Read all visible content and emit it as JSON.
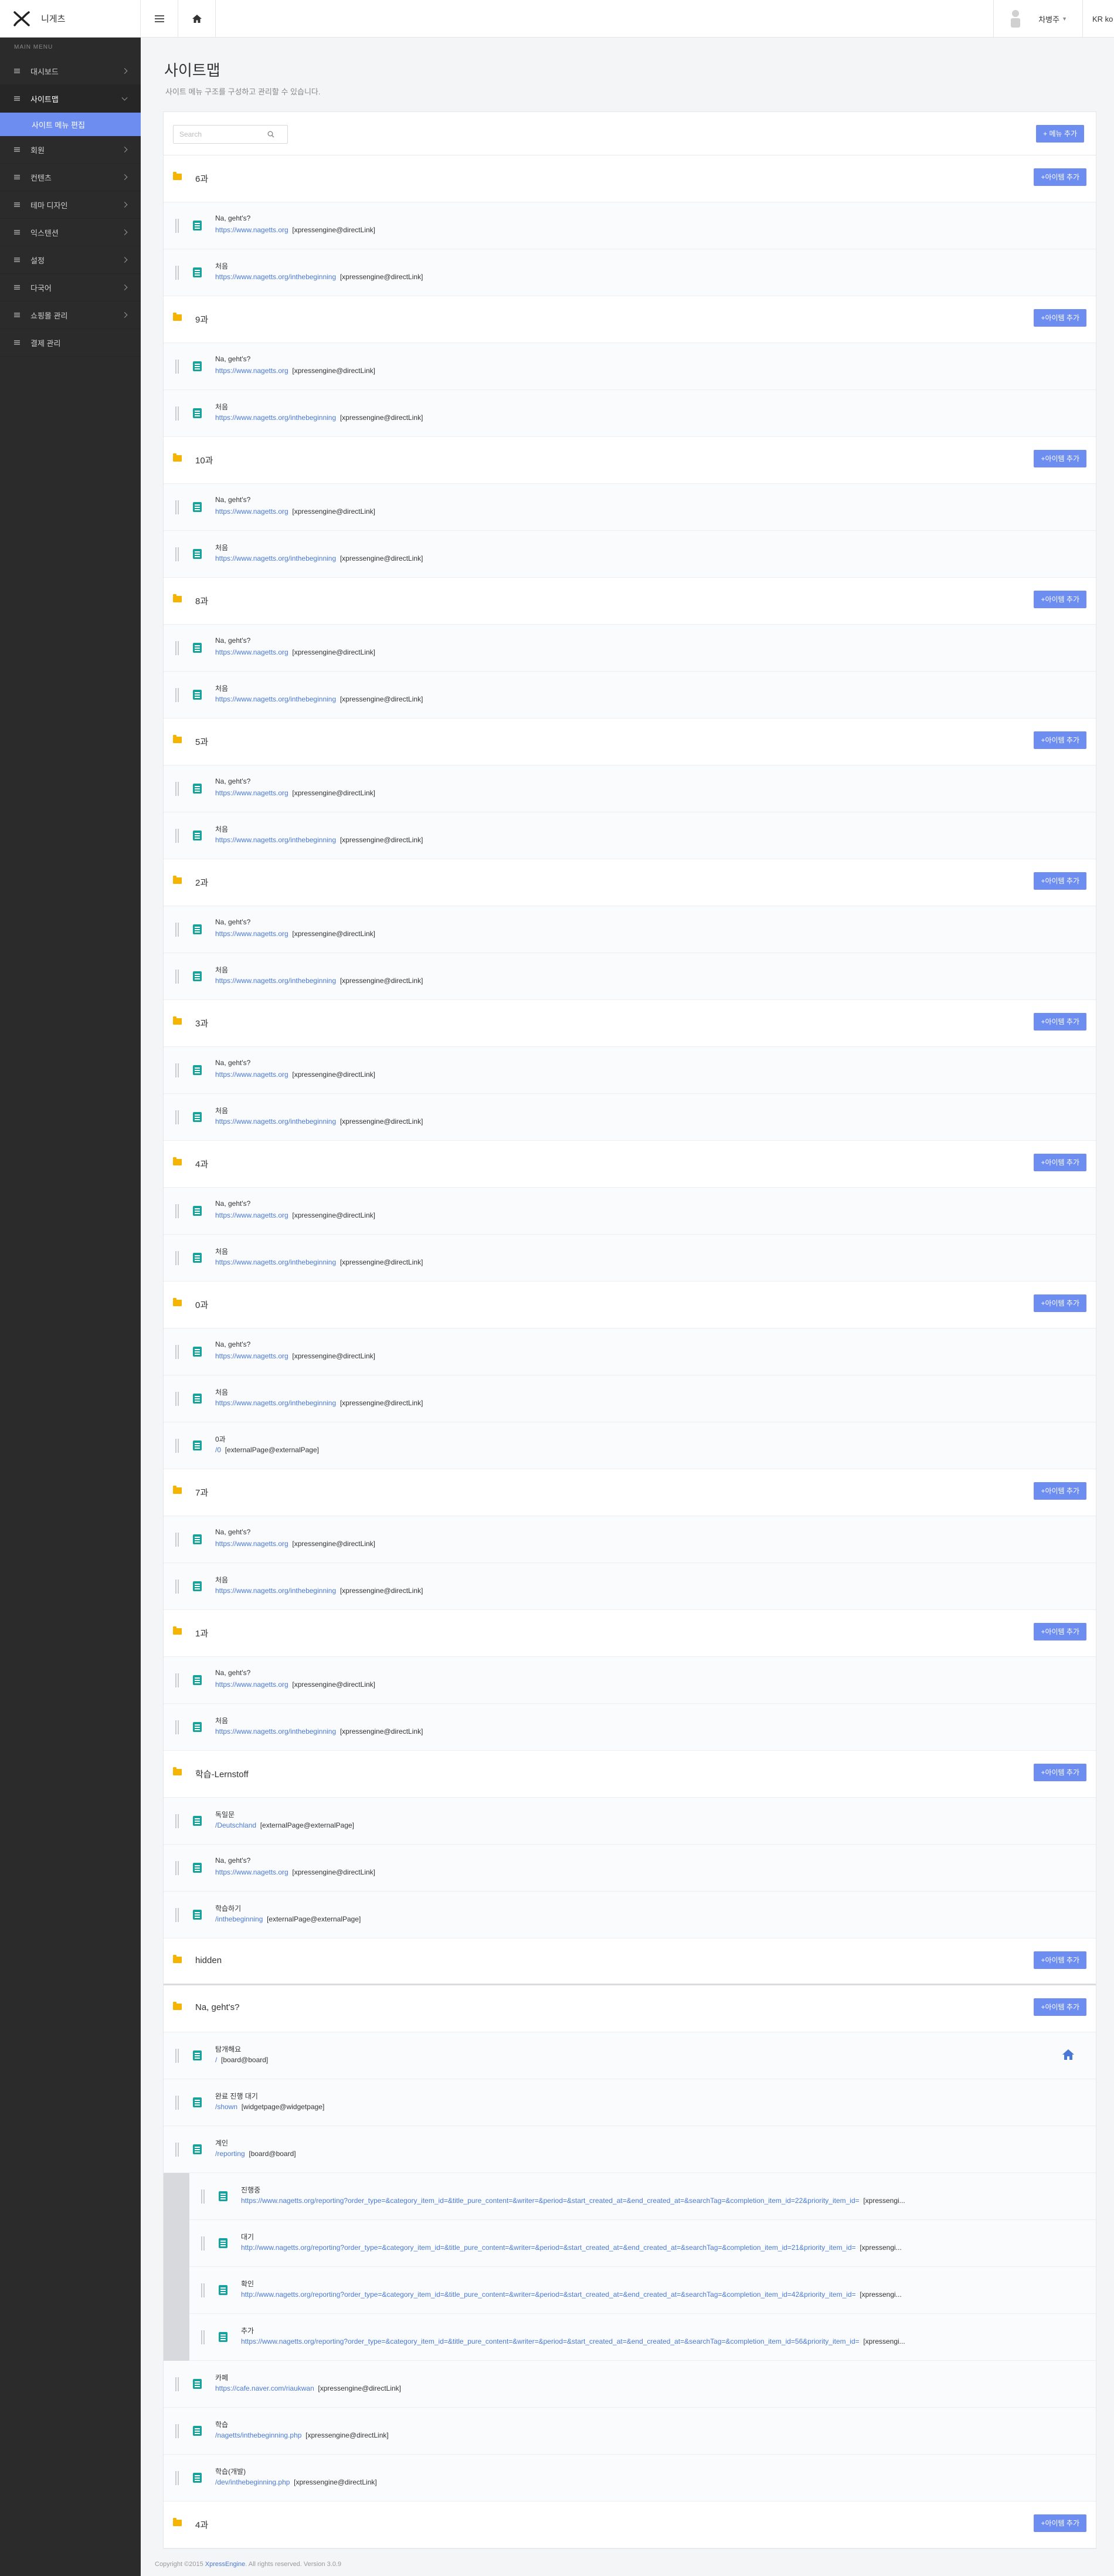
{
  "header": {
    "site_name": "니게츠",
    "user_name": "차병주",
    "lang": "KR ko"
  },
  "sidebar": {
    "heading": "MAIN MENU",
    "items": [
      {
        "label": "대시보드"
      },
      {
        "label": "사이트맵"
      },
      {
        "label": "회원"
      },
      {
        "label": "컨텐츠"
      },
      {
        "label": "테마 디자인"
      },
      {
        "label": "익스텐션"
      },
      {
        "label": "설정"
      },
      {
        "label": "다국어"
      },
      {
        "label": "쇼핑몰 관리"
      },
      {
        "label": "결제 관리"
      }
    ],
    "active_sub": "사이트 메뉴 편집"
  },
  "page": {
    "title": "사이트맵",
    "description": "사이트 메뉴 구조를 구성하고 관리할 수 있습니다.",
    "search_placeholder": "Search",
    "add_menu_label": "+ 메뉴 추가",
    "add_item_label": "+아이템 추가"
  },
  "menus": [
    {
      "title": "6과",
      "items": [
        {
          "title": "Na, geht's?",
          "url": "https://www.nagetts.org",
          "type": "[xpressengine@directLink]"
        },
        {
          "title": "처음",
          "url": "https://www.nagetts.org/inthebeginning",
          "type": "[xpressengine@directLink]"
        }
      ]
    },
    {
      "title": "9과",
      "items": [
        {
          "title": "Na, geht's?",
          "url": "https://www.nagetts.org",
          "type": "[xpressengine@directLink]"
        },
        {
          "title": "처음",
          "url": "https://www.nagetts.org/inthebeginning",
          "type": "[xpressengine@directLink]"
        }
      ]
    },
    {
      "title": "10과",
      "items": [
        {
          "title": "Na, geht's?",
          "url": "https://www.nagetts.org",
          "type": "[xpressengine@directLink]"
        },
        {
          "title": "처음",
          "url": "https://www.nagetts.org/inthebeginning",
          "type": "[xpressengine@directLink]"
        }
      ]
    },
    {
      "title": "8과",
      "items": [
        {
          "title": "Na, geht's?",
          "url": "https://www.nagetts.org",
          "type": "[xpressengine@directLink]"
        },
        {
          "title": "처음",
          "url": "https://www.nagetts.org/inthebeginning",
          "type": "[xpressengine@directLink]"
        }
      ]
    },
    {
      "title": "5과",
      "items": [
        {
          "title": "Na, geht's?",
          "url": "https://www.nagetts.org",
          "type": "[xpressengine@directLink]"
        },
        {
          "title": "처음",
          "url": "https://www.nagetts.org/inthebeginning",
          "type": "[xpressengine@directLink]"
        }
      ]
    },
    {
      "title": "2과",
      "items": [
        {
          "title": "Na, geht's?",
          "url": "https://www.nagetts.org",
          "type": "[xpressengine@directLink]"
        },
        {
          "title": "처음",
          "url": "https://www.nagetts.org/inthebeginning",
          "type": "[xpressengine@directLink]"
        }
      ]
    },
    {
      "title": "3과",
      "items": [
        {
          "title": "Na, geht's?",
          "url": "https://www.nagetts.org",
          "type": "[xpressengine@directLink]"
        },
        {
          "title": "처음",
          "url": "https://www.nagetts.org/inthebeginning",
          "type": "[xpressengine@directLink]"
        }
      ]
    },
    {
      "title": "4과",
      "items": [
        {
          "title": "Na, geht's?",
          "url": "https://www.nagetts.org",
          "type": "[xpressengine@directLink]"
        },
        {
          "title": "처음",
          "url": "https://www.nagetts.org/inthebeginning",
          "type": "[xpressengine@directLink]"
        }
      ]
    },
    {
      "title": "0과",
      "items": [
        {
          "title": "Na, geht's?",
          "url": "https://www.nagetts.org",
          "type": "[xpressengine@directLink]"
        },
        {
          "title": "처음",
          "url": "https://www.nagetts.org/inthebeginning",
          "type": "[xpressengine@directLink]"
        },
        {
          "title": "0과",
          "url": "/0",
          "type": "[externalPage@externalPage]"
        }
      ]
    },
    {
      "title": "7과",
      "items": [
        {
          "title": "Na, geht's?",
          "url": "https://www.nagetts.org",
          "type": "[xpressengine@directLink]"
        },
        {
          "title": "처음",
          "url": "https://www.nagetts.org/inthebeginning",
          "type": "[xpressengine@directLink]"
        }
      ]
    },
    {
      "title": "1과",
      "items": [
        {
          "title": "Na, geht's?",
          "url": "https://www.nagetts.org",
          "type": "[xpressengine@directLink]"
        },
        {
          "title": "처음",
          "url": "https://www.nagetts.org/inthebeginning",
          "type": "[xpressengine@directLink]"
        }
      ]
    },
    {
      "title": "학습-Lernstoff",
      "items": [
        {
          "title": "독일문",
          "url": "/Deutschland",
          "type": "[externalPage@externalPage]"
        },
        {
          "title": "Na, geht's?",
          "url": "https://www.nagetts.org",
          "type": "[xpressengine@directLink]"
        },
        {
          "title": "학습하기",
          "url": "/inthebeginning",
          "type": "[externalPage@externalPage]"
        }
      ]
    },
    {
      "title": "hidden",
      "items": []
    },
    {
      "title": "Na, geht's?",
      "items": [
        {
          "title": "탐개해요",
          "url": "/",
          "type": "[board@board]",
          "home": true
        },
        {
          "title": "완료 진행 대기",
          "url": "/shown",
          "type": "[widgetpage@widgetpage]"
        },
        {
          "title": "계인",
          "url": "/reporting",
          "type": "[board@board]"
        },
        {
          "title": "진행중",
          "url": "https://www.nagetts.org/reporting?order_type=&category_item_id=&title_pure_content=&writer=&period=&start_created_at=&end_created_at=&searchTag=&completion_item_id=22&priority_item_id=",
          "type": "[xpressengi...",
          "depth": 1
        },
        {
          "title": "대기",
          "url": "http://www.nagetts.org/reporting?order_type=&category_item_id=&title_pure_content=&writer=&period=&start_created_at=&end_created_at=&searchTag=&completion_item_id=21&priority_item_id=",
          "type": "[xpressengi...",
          "depth": 1
        },
        {
          "title": "확인",
          "url": "http://www.nagetts.org/reporting?order_type=&category_item_id=&title_pure_content=&writer=&period=&start_created_at=&end_created_at=&searchTag=&completion_item_id=42&priority_item_id=",
          "type": "[xpressengi...",
          "depth": 1
        },
        {
          "title": "추가",
          "url": "https://www.nagetts.org/reporting?order_type=&category_item_id=&title_pure_content=&writer=&period=&start_created_at=&end_created_at=&searchTag=&completion_item_id=56&priority_item_id=",
          "type": "[xpressengi...",
          "depth": 1
        },
        {
          "title": "카페",
          "url": "https://cafe.naver.com/riaukwan",
          "type": "[xpressengine@directLink]"
        },
        {
          "title": "학습",
          "url": "/nagetts/inthebeginning.php",
          "type": "[xpressengine@directLink]"
        },
        {
          "title": "학습(개발)",
          "url": "/dev/inthebeginning.php",
          "type": "[xpressengine@directLink]"
        }
      ]
    },
    {
      "title": "4과",
      "items": []
    }
  ],
  "footer": {
    "prefix": "Copyright ©2015 ",
    "brand": "XpressEngine",
    "suffix": ". All rights reserved. Version 3.0.9"
  }
}
